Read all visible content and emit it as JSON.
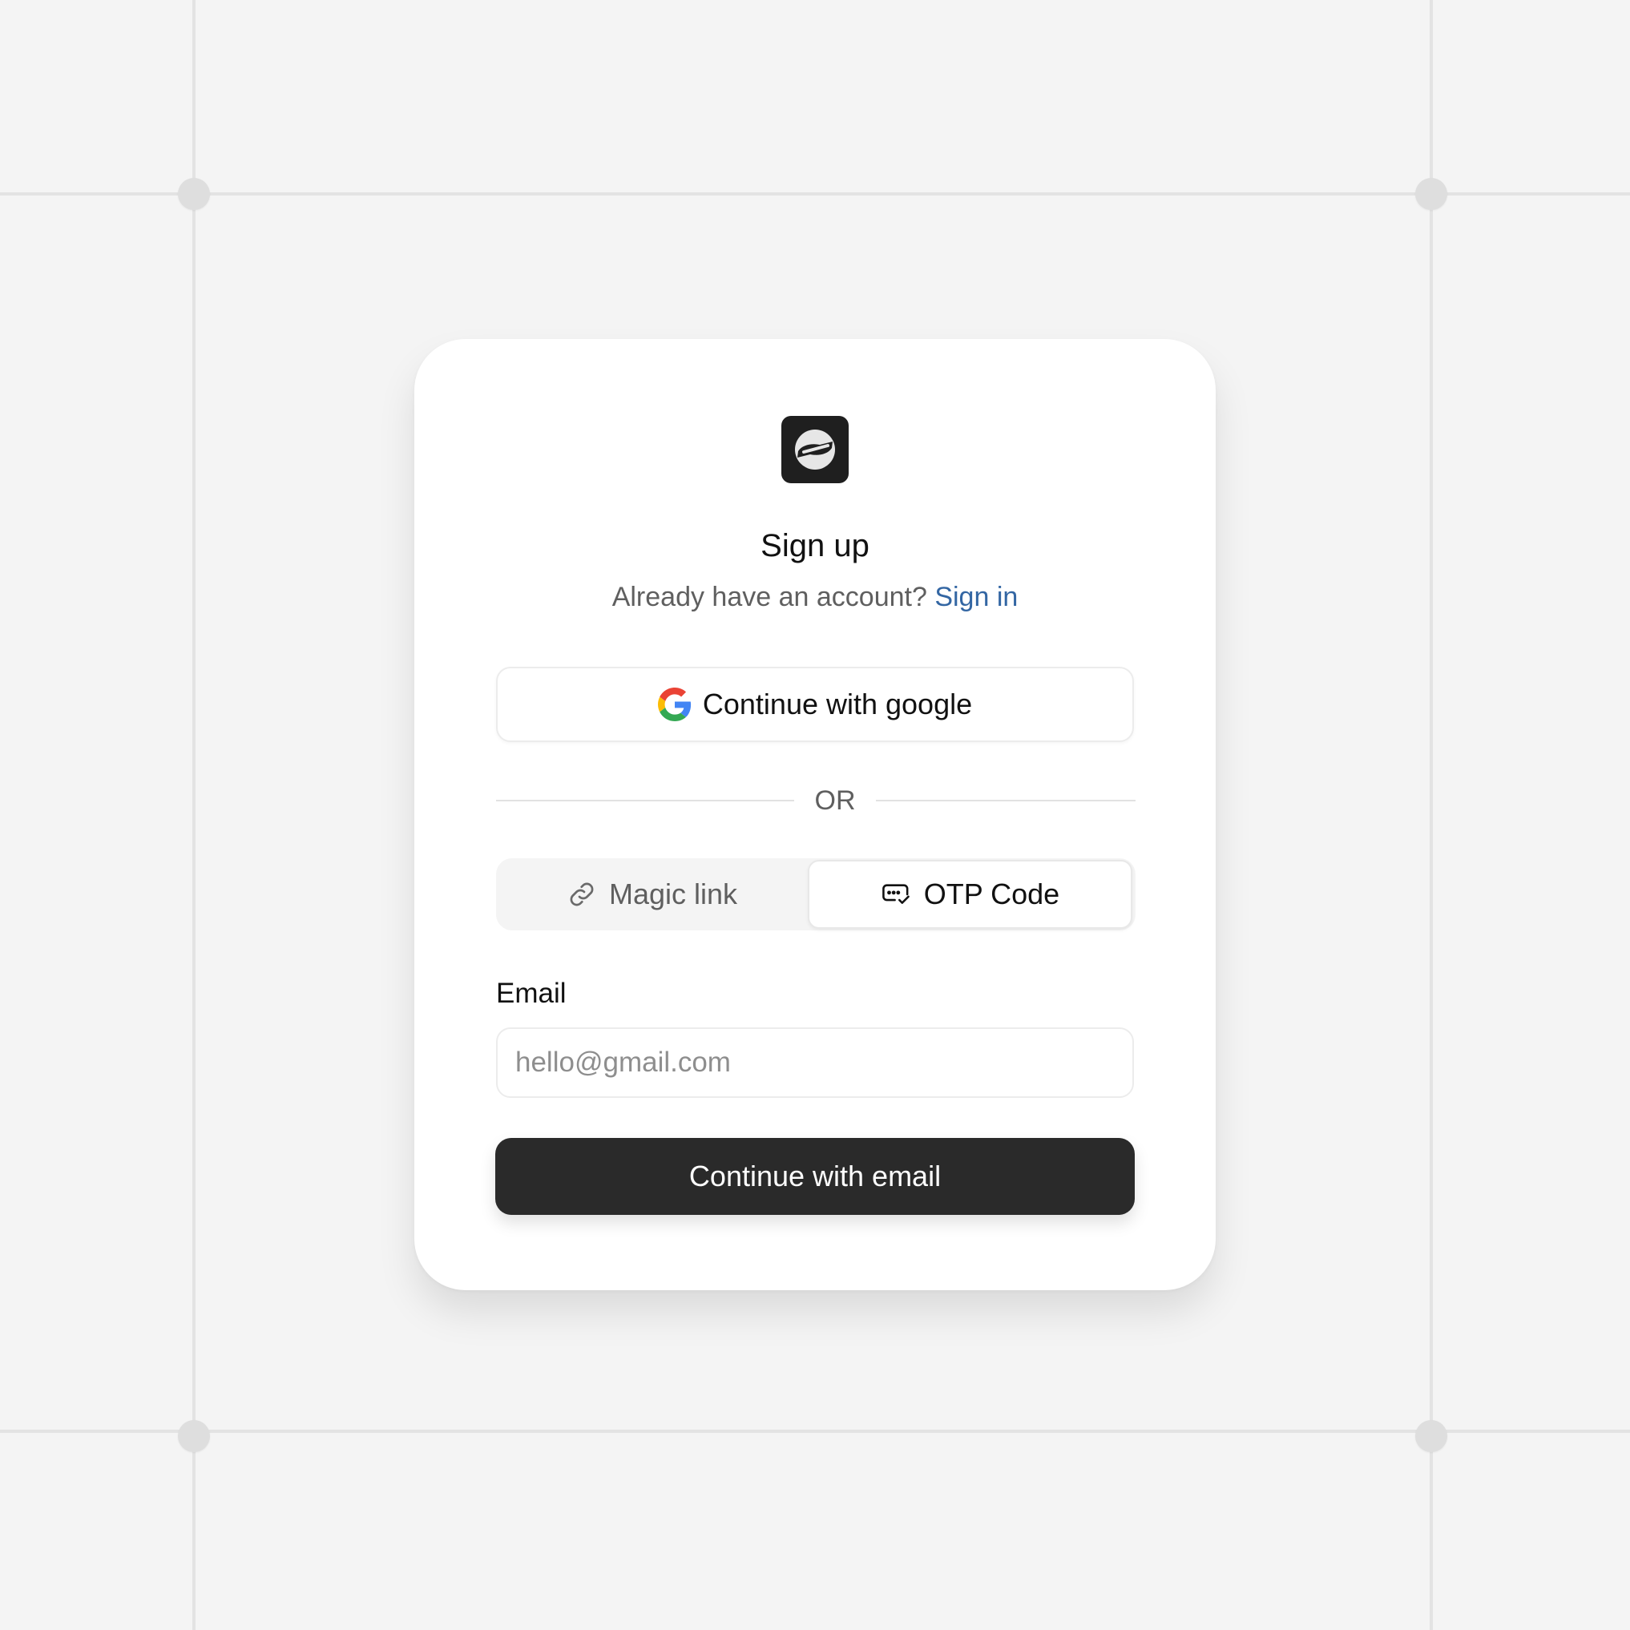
{
  "header": {
    "title": "Sign up",
    "subtitle_prefix": "Already have an account?",
    "signin_link": "Sign in"
  },
  "social": {
    "google_label": "Continue with google",
    "icon": "google-logo"
  },
  "divider": {
    "label": "OR"
  },
  "method_tabs": [
    {
      "label": "Magic link",
      "icon": "link-icon",
      "selected": false
    },
    {
      "label": "OTP Code",
      "icon": "otp-message-icon",
      "selected": true
    }
  ],
  "form": {
    "email_label": "Email",
    "email_placeholder": "hello@gmail.com",
    "email_value": "",
    "submit_label": "Continue with email"
  },
  "colors": {
    "background": "#f4f4f4",
    "card": "#ffffff",
    "primary_button": "#2a2a2a",
    "link": "#3366a3",
    "muted_text": "#5f5f5f"
  }
}
